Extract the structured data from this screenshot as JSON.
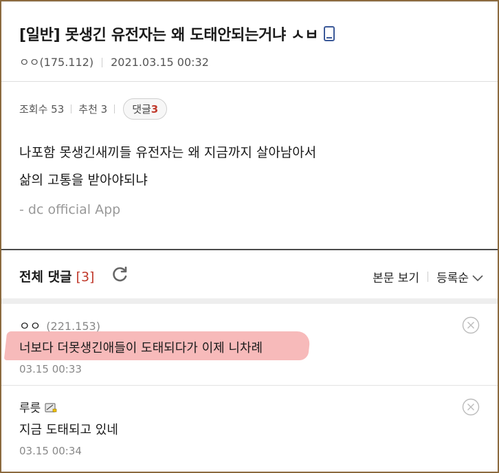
{
  "post": {
    "title": "[일반] 못생긴 유전자는 왜 도태안되는거냐 ㅅㅂ",
    "author": "ㅇㅇ(175.112)",
    "date": "2021.03.15 00:32",
    "views_label": "조회수 53",
    "recommend_label": "추천 3",
    "comments_label": "댓글",
    "comments_count": "3",
    "body_lines": [
      "나포함 못생긴새끼들 유전자는 왜 지금까지 살아남아서",
      "삶의 고통을 받아야되냐"
    ],
    "signature": "- dc official App",
    "icons": {
      "device": "mobile-phone-icon"
    }
  },
  "comments_section": {
    "title": "전체 댓글",
    "count_display": "[3]",
    "view_body_label": "본문 보기",
    "sort_label": "등록순",
    "icons": {
      "refresh": "refresh-icon",
      "sort": "chevron-down-icon"
    }
  },
  "comments": [
    {
      "author": "ㅇㅇ",
      "ip": "(221.153)",
      "text": "너보다 더못생긴애들이 도태되다가 이제 니차례",
      "date": "03.15 00:33",
      "highlighted": true
    },
    {
      "author": "루릇",
      "text": "지금 도태되고 있네",
      "date": "03.15 00:34",
      "badge_icon": "mobile-badge-icon"
    }
  ],
  "colors": {
    "accent_red": "#c0392b",
    "highlight": "#f08282",
    "frame": "#8b6a3e"
  }
}
